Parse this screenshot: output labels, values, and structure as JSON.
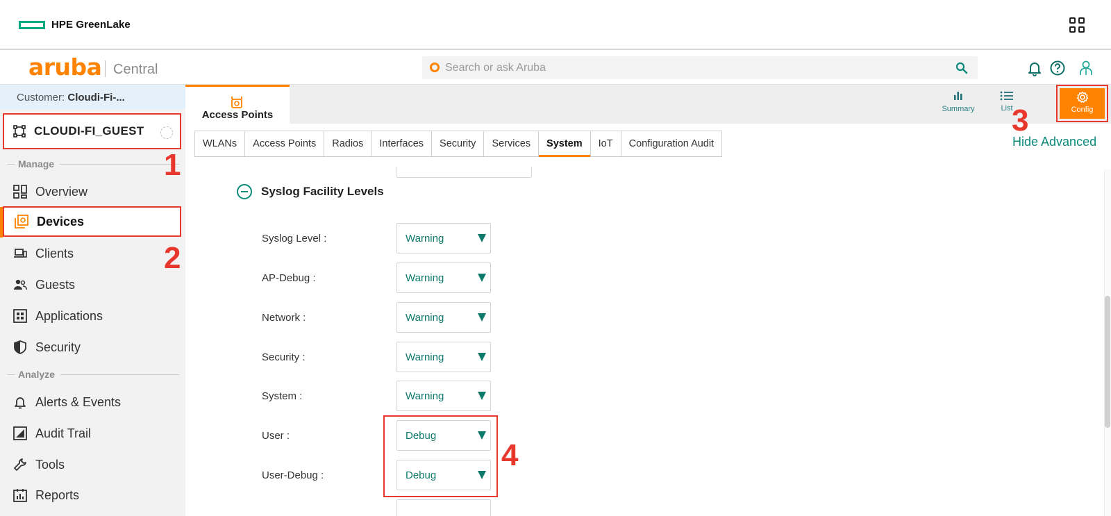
{
  "greenlake": {
    "brand": "HPE GreenLake",
    "app_launcher_icon": "grid-icon"
  },
  "aruba_header": {
    "logo": "aruba",
    "product": "Central",
    "search": {
      "placeholder": "Search or ask Aruba"
    },
    "icons": [
      "bell-icon",
      "help-icon",
      "user-icon"
    ]
  },
  "sidebar": {
    "customer_label": "Customer:",
    "customer_name": "Cloudi-Fi-...",
    "group": "CLOUDI-FI_GUEST",
    "sections": {
      "manage": "Manage",
      "analyze": "Analyze"
    },
    "items": [
      {
        "label": "Overview",
        "icon": "overview-icon"
      },
      {
        "label": "Devices",
        "icon": "devices-icon",
        "active": true
      },
      {
        "label": "Clients",
        "icon": "clients-icon"
      },
      {
        "label": "Guests",
        "icon": "guests-icon"
      },
      {
        "label": "Applications",
        "icon": "applications-icon"
      },
      {
        "label": "Security",
        "icon": "security-icon"
      },
      {
        "label": "Alerts & Events",
        "icon": "alerts-icon"
      },
      {
        "label": "Audit Trail",
        "icon": "audit-trail-icon"
      },
      {
        "label": "Tools",
        "icon": "tools-icon"
      },
      {
        "label": "Reports",
        "icon": "reports-icon"
      }
    ]
  },
  "main": {
    "device_tab": "Access Points",
    "views": {
      "summary": "Summary",
      "list": "List",
      "config": "Config"
    },
    "subtabs": [
      "WLANs",
      "Access Points",
      "Radios",
      "Interfaces",
      "Security",
      "Services",
      "System",
      "IoT",
      "Configuration Audit"
    ],
    "active_subtab": "System",
    "hide_advanced": "Hide Advanced",
    "section_title": "Syslog Facility Levels",
    "syslog_rows": [
      {
        "label": "Syslog Level :",
        "value": "Warning"
      },
      {
        "label": "AP-Debug :",
        "value": "Warning"
      },
      {
        "label": "Network :",
        "value": "Warning"
      },
      {
        "label": "Security :",
        "value": "Warning"
      },
      {
        "label": "System :",
        "value": "Warning"
      },
      {
        "label": "User :",
        "value": "Debug"
      },
      {
        "label": "User-Debug :",
        "value": "Debug"
      }
    ]
  },
  "annotations": [
    "1",
    "2",
    "3",
    "4"
  ],
  "colors": {
    "accent": "#ff8300",
    "teal": "#0d7a6c",
    "highlight": "#e8372c",
    "greenlake": "#01a982"
  }
}
